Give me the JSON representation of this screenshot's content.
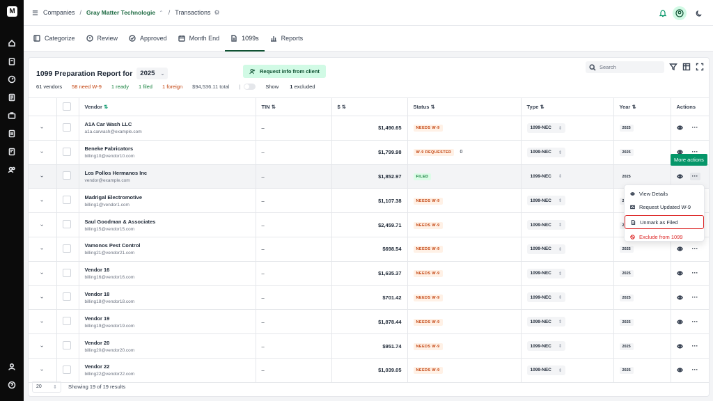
{
  "app": {
    "logo": "M"
  },
  "topbar": {
    "companies": "Companies",
    "company": "Gray Matter Technologie",
    "transactions": "Transactions"
  },
  "tabs": [
    {
      "label": "Categorize",
      "icon": "categorize-icon"
    },
    {
      "label": "Review",
      "icon": "review-icon"
    },
    {
      "label": "Approved",
      "icon": "approved-icon"
    },
    {
      "label": "Month End",
      "icon": "calendar-icon"
    },
    {
      "label": "1099s",
      "icon": "document-icon"
    },
    {
      "label": "Reports",
      "icon": "reports-icon"
    }
  ],
  "report": {
    "title": "1099 Preparation Report for",
    "year": "2025",
    "request_label": "Request info from client",
    "search_placeholder": "Search",
    "stats": {
      "vendors": "61 vendors",
      "need_w9": "58 need W-9",
      "ready": "1 ready",
      "filed": "1 filed",
      "foreign": "1 foreign",
      "total": "$94,536.11 total",
      "sep": "|",
      "show_excluded": "Show",
      "excluded_count": "1",
      "excluded_word": "excluded"
    }
  },
  "table": {
    "headers": {
      "vendor": "Vendor",
      "tin": "TIN",
      "amount": "$",
      "status": "Status",
      "type": "Type",
      "year": "Year",
      "actions": "Actions"
    },
    "rows": [
      {
        "name": "A1A Car Wash LLC",
        "email": "a1a.carwash@example.com",
        "tin": "–",
        "amount": "$1,490.65",
        "status": "NEEDS W-9",
        "type": "1099-NEC",
        "year": "2025"
      },
      {
        "name": "Beneke Fabricators",
        "email": "billing10@vendor10.com",
        "tin": "–",
        "amount": "$1,799.98",
        "status": "W-9 REQUESTED",
        "status_count": "0",
        "type": "1099-NEC",
        "year": "2025"
      },
      {
        "name": "Los Pollos Hermanos Inc",
        "email": "vendor@example.com",
        "tin": "–",
        "amount": "$1,852.97",
        "status": "FILED",
        "type": "1099-NEC",
        "year": "2025"
      },
      {
        "name": "Madrigal Electromotive",
        "email": "billing1@vendor1.com",
        "tin": "–",
        "amount": "$1,107.38",
        "status": "NEEDS W-9",
        "type": "1099-NEC",
        "year": "2025"
      },
      {
        "name": "Saul Goodman & Associates",
        "email": "billing15@vendor15.com",
        "tin": "–",
        "amount": "$2,459.71",
        "status": "NEEDS W-9",
        "type": "1099-NEC",
        "year": "2025"
      },
      {
        "name": "Vamonos Pest Control",
        "email": "billing21@vendor21.com",
        "tin": "–",
        "amount": "$698.54",
        "status": "NEEDS W-9",
        "type": "1099-NEC",
        "year": "2025"
      },
      {
        "name": "Vendor 16",
        "email": "billing16@vendor16.com",
        "tin": "–",
        "amount": "$1,635.37",
        "status": "NEEDS W-9",
        "type": "1099-NEC",
        "year": "2025"
      },
      {
        "name": "Vendor 18",
        "email": "billing18@vendor18.com",
        "tin": "–",
        "amount": "$701.42",
        "status": "NEEDS W-9",
        "type": "1099-NEC",
        "year": "2025"
      },
      {
        "name": "Vendor 19",
        "email": "billing19@vendor19.com",
        "tin": "–",
        "amount": "$1,878.44",
        "status": "NEEDS W-9",
        "type": "1099-NEC",
        "year": "2025"
      },
      {
        "name": "Vendor 20",
        "email": "billing20@vendor20.com",
        "tin": "–",
        "amount": "$951.74",
        "status": "NEEDS W-9",
        "type": "1099-NEC",
        "year": "2025"
      },
      {
        "name": "Vendor 22",
        "email": "billing22@vendor22.com",
        "tin": "–",
        "amount": "$1,039.05",
        "status": "NEEDS W-9",
        "type": "1099-NEC",
        "year": "2025"
      }
    ]
  },
  "footer": {
    "per_page": "20",
    "showing": "Showing 19 of 19 results"
  },
  "tooltip": "More actions",
  "menu": {
    "view": "View Details",
    "request": "Request Updated W-9",
    "unmark": "Unmark as Filed",
    "exclude": "Exclude from 1099"
  },
  "colors": {
    "accent": "#0f5132",
    "needs": "#c2410c",
    "filed": "#15803d",
    "danger": "#dc2626",
    "tooltip": "#059669"
  }
}
